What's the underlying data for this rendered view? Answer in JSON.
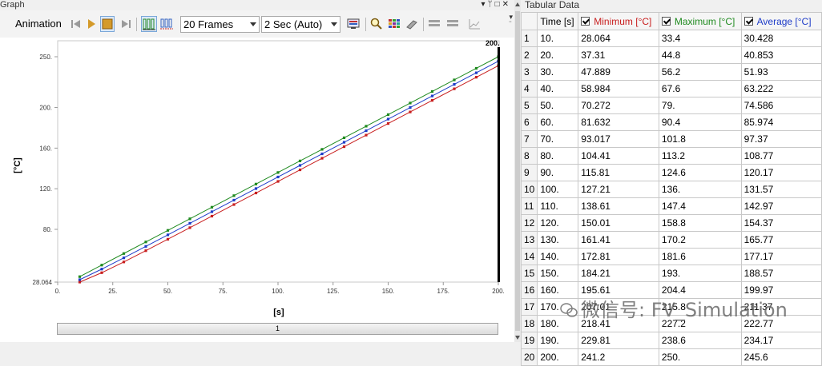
{
  "graph": {
    "title": "Graph",
    "toolbar": {
      "animation_label": "Animation",
      "frames_select": "20 Frames",
      "duration_select": "2 Sec (Auto)"
    },
    "slider_label": "1"
  },
  "chart_data": {
    "type": "line",
    "xlabel": "[s]",
    "ylabel": "[°C]",
    "xlim": [
      0,
      200
    ],
    "ylim": [
      28.064,
      250
    ],
    "x_ticks": [
      "0.",
      "25.",
      "50.",
      "75.",
      "100.",
      "125.",
      "150.",
      "175.",
      "200."
    ],
    "y_ticks": [
      "28.064",
      "80.",
      "120.",
      "160.",
      "200.",
      "250."
    ],
    "cursor_label": "200.",
    "x": [
      10,
      20,
      30,
      40,
      50,
      60,
      70,
      80,
      90,
      100,
      110,
      120,
      130,
      140,
      150,
      160,
      170,
      180,
      190,
      200
    ],
    "series": [
      {
        "name": "Minimum",
        "color": "#c81e1e",
        "values": [
          28.064,
          37.31,
          47.889,
          58.984,
          70.272,
          81.632,
          93.017,
          104.41,
          115.81,
          127.21,
          138.61,
          150.01,
          161.41,
          172.81,
          184.21,
          195.61,
          207.01,
          218.41,
          229.81,
          241.2
        ]
      },
      {
        "name": "Maximum",
        "color": "#1f8a1f",
        "values": [
          33.4,
          44.8,
          56.2,
          67.6,
          79,
          90.4,
          101.8,
          113.2,
          124.6,
          136,
          147.4,
          158.8,
          170.2,
          181.6,
          193,
          204.4,
          215.8,
          227.2,
          238.6,
          250
        ]
      },
      {
        "name": "Average",
        "color": "#1e3cc8",
        "values": [
          30.428,
          40.853,
          51.93,
          63.222,
          74.586,
          85.974,
          97.37,
          108.77,
          120.17,
          131.57,
          142.97,
          154.37,
          165.77,
          177.17,
          188.57,
          199.97,
          211.37,
          222.77,
          234.17,
          245.6
        ]
      }
    ]
  },
  "table": {
    "title": "Tabular Data",
    "headers": [
      "",
      "Time [s]",
      "Minimum [°C]",
      "Maximum [°C]",
      "Average [°C]"
    ],
    "rows": [
      [
        "1",
        "10.",
        "28.064",
        "33.4",
        "30.428"
      ],
      [
        "2",
        "20.",
        "37.31",
        "44.8",
        "40.853"
      ],
      [
        "3",
        "30.",
        "47.889",
        "56.2",
        "51.93"
      ],
      [
        "4",
        "40.",
        "58.984",
        "67.6",
        "63.222"
      ],
      [
        "5",
        "50.",
        "70.272",
        "79.",
        "74.586"
      ],
      [
        "6",
        "60.",
        "81.632",
        "90.4",
        "85.974"
      ],
      [
        "7",
        "70.",
        "93.017",
        "101.8",
        "97.37"
      ],
      [
        "8",
        "80.",
        "104.41",
        "113.2",
        "108.77"
      ],
      [
        "9",
        "90.",
        "115.81",
        "124.6",
        "120.17"
      ],
      [
        "10",
        "100.",
        "127.21",
        "136.",
        "131.57"
      ],
      [
        "11",
        "110.",
        "138.61",
        "147.4",
        "142.97"
      ],
      [
        "12",
        "120.",
        "150.01",
        "158.8",
        "154.37"
      ],
      [
        "13",
        "130.",
        "161.41",
        "170.2",
        "165.77"
      ],
      [
        "14",
        "140.",
        "172.81",
        "181.6",
        "177.17"
      ],
      [
        "15",
        "150.",
        "184.21",
        "193.",
        "188.57"
      ],
      [
        "16",
        "160.",
        "195.61",
        "204.4",
        "199.97"
      ],
      [
        "17",
        "170.",
        "207.01",
        "215.8",
        "211.37"
      ],
      [
        "18",
        "180.",
        "218.41",
        "227.2",
        "222.77"
      ],
      [
        "19",
        "190.",
        "229.81",
        "238.6",
        "234.17"
      ],
      [
        "20",
        "200.",
        "241.2",
        "250.",
        "245.6"
      ]
    ]
  },
  "watermark": "微信号: FV_Simulation"
}
